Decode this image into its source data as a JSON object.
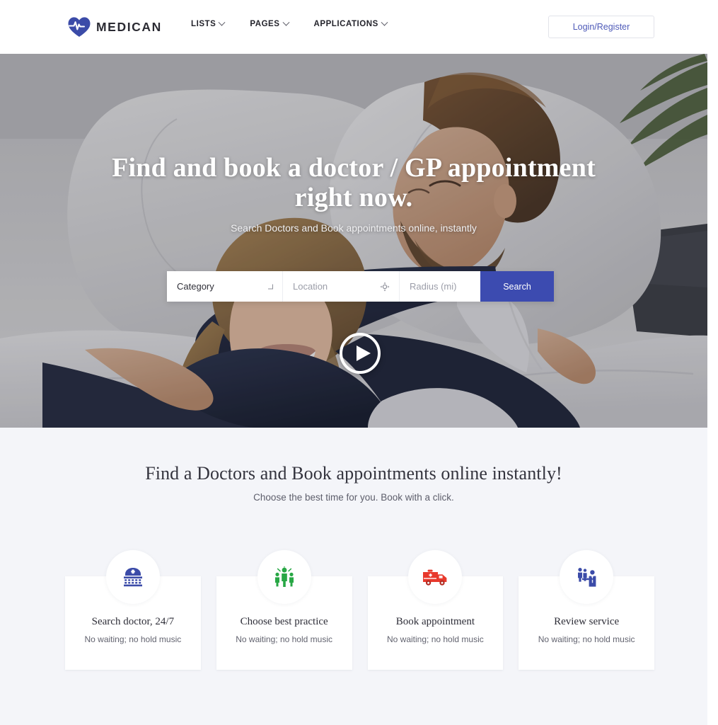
{
  "header": {
    "logo_text": "MEDICAN",
    "logo_icon": "heart-pulse-icon",
    "nav": [
      {
        "label": "LISTS",
        "icon": "chevron-down-icon"
      },
      {
        "label": "PAGES",
        "icon": "chevron-down-icon"
      },
      {
        "label": "APPLICATIONS",
        "icon": "chevron-down-icon"
      }
    ],
    "login_label": "Login/Register",
    "login_color": "#4e5ab8"
  },
  "hero": {
    "title": "Find and book a doctor / GP appointment right now.",
    "subtitle": "Search Doctors and Book appointments online, instantly",
    "play_icon": "play-circle-icon",
    "search": {
      "category_value": "Category",
      "category_icon": "chevron-down-icon",
      "location_placeholder": "Location",
      "location_icon": "crosshair-locate-icon",
      "radius_placeholder": "Radius (mi)",
      "submit_label": "Search",
      "submit_color": "#3c4bb0"
    }
  },
  "features": {
    "title": "Find a Doctors and Book appointments online instantly!",
    "subtitle": "Choose the best time for you. Book with a click.",
    "cards": [
      {
        "icon": "hospital-building-icon",
        "icon_color": "#3b4ba8",
        "title": "Search doctor, 24/7",
        "subtitle": "No waiting; no hold music"
      },
      {
        "icon": "people-group-icon",
        "icon_color": "#28a745",
        "title": "Choose best practice",
        "subtitle": "No waiting; no hold music"
      },
      {
        "icon": "ambulance-icon",
        "icon_color": "#e8392c",
        "title": "Book appointment",
        "subtitle": "No waiting; no hold music"
      },
      {
        "icon": "doctor-consultation-icon",
        "icon_color": "#3b4ba8",
        "title": "Review service",
        "subtitle": "No waiting; no hold music"
      }
    ]
  },
  "theme": {
    "page_background": "#f4f5f9",
    "brand_blue": "#3c4bb0",
    "header_background": "#ffffff"
  }
}
